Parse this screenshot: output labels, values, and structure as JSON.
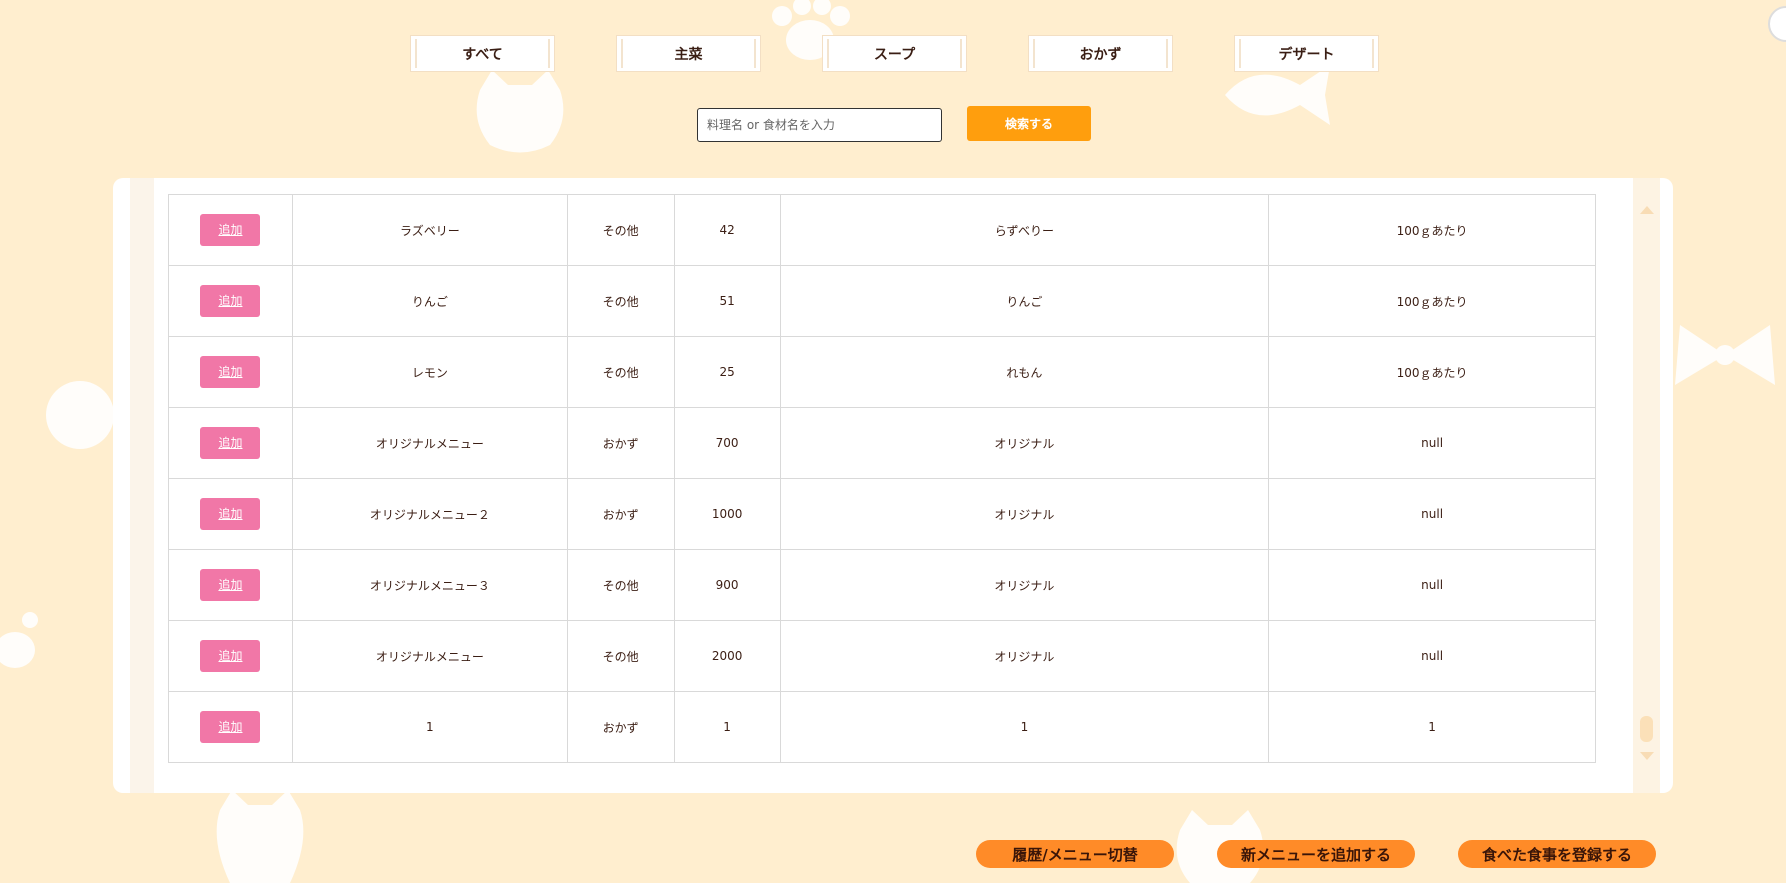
{
  "tabs": [
    "すべて",
    "主菜",
    "スープ",
    "おかず",
    "デザート"
  ],
  "search": {
    "placeholder": "料理名 or 食材名を入力",
    "button_label": "検索する"
  },
  "table": {
    "add_label": "追加",
    "rows": [
      [
        "ラズベリー",
        "その他",
        "42",
        "らずべりー",
        "100ｇあたり"
      ],
      [
        "りんご",
        "その他",
        "51",
        "りんご",
        "100ｇあたり"
      ],
      [
        "レモン",
        "その他",
        "25",
        "れもん",
        "100ｇあたり"
      ],
      [
        "オリジナルメニュー",
        "おかず",
        "700",
        "オリジナル",
        "null"
      ],
      [
        "オリジナルメニュー２",
        "おかず",
        "1000",
        "オリジナル",
        "null"
      ],
      [
        "オリジナルメニュー３",
        "その他",
        "900",
        "オリジナル",
        "null"
      ],
      [
        "オリジナルメニュー",
        "その他",
        "2000",
        "オリジナル",
        "null"
      ],
      [
        "1",
        "おかず",
        "1",
        "1",
        "1"
      ]
    ]
  },
  "actions": {
    "history_toggle": "履歴/メニュー切替",
    "add_menu": "新メニューを追加する",
    "register_meal": "食べた食事を登録する"
  },
  "colors": {
    "background": "#ffeecf",
    "search_button": "#ff9e0d",
    "add_button": "#f177a7",
    "action_button": "#ff8b28"
  }
}
